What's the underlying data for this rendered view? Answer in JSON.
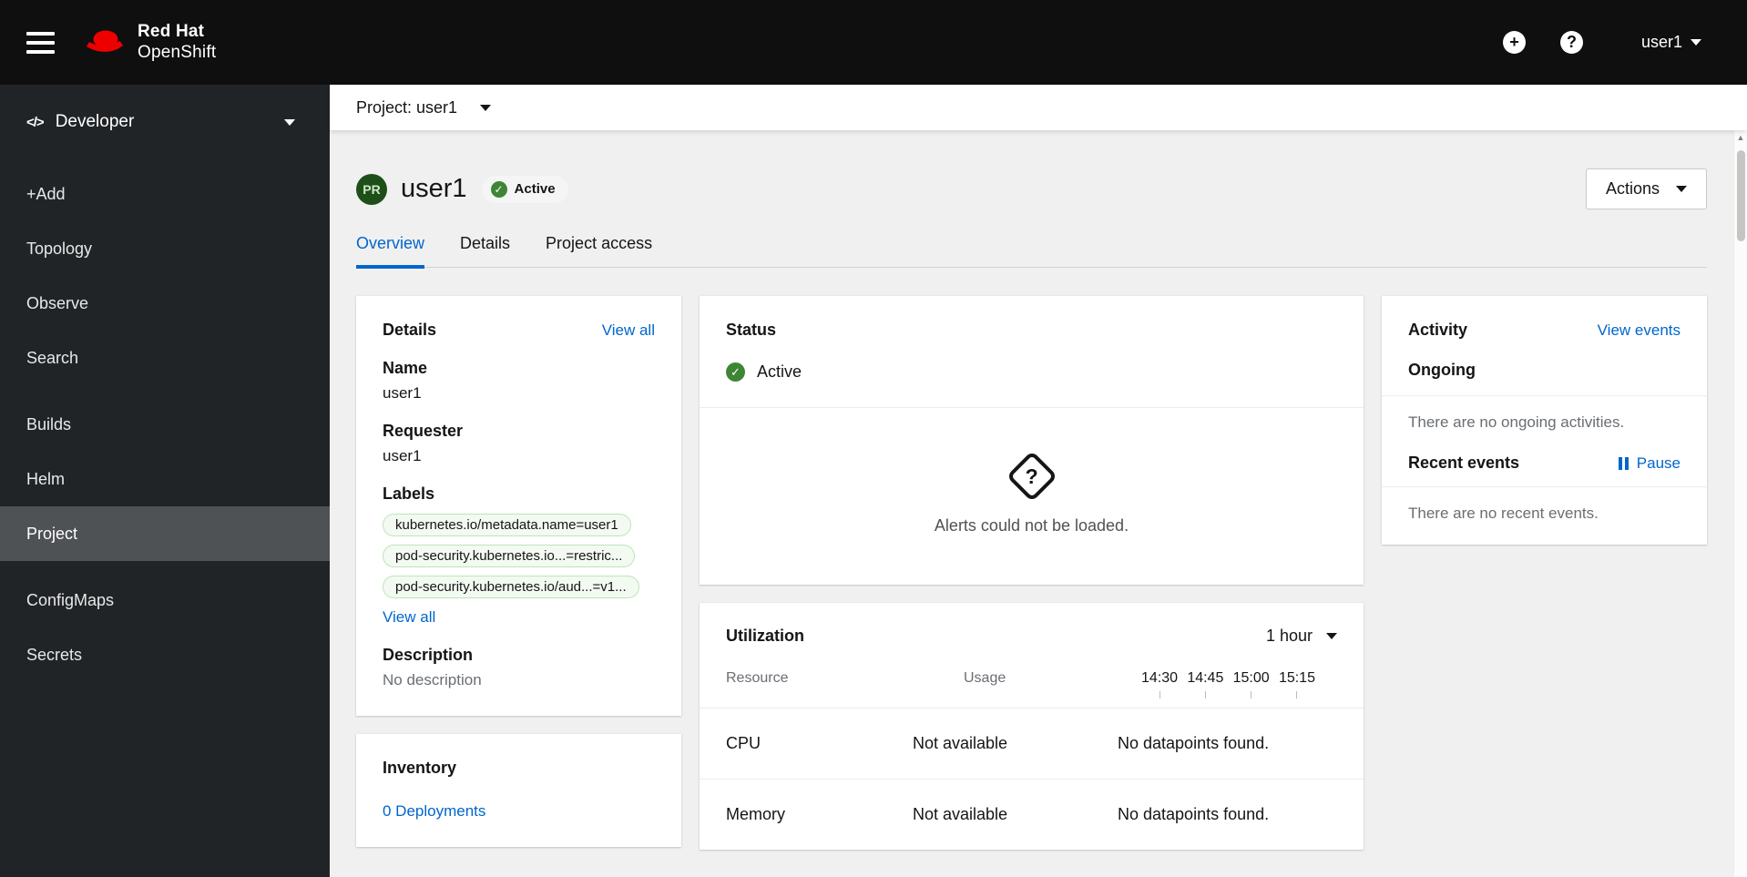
{
  "colors": {
    "accent_blue": "#0066cc",
    "success_green": "#3e8635",
    "brand_red": "#ee0000",
    "project_badge_green": "#1e4f18",
    "label_pill_bg": "#f3faf2",
    "label_pill_border": "#bde5b8",
    "masthead_bg": "#0f0f0f",
    "sidebar_bg": "#212427",
    "sidebar_selected_bg": "#4f5255"
  },
  "icons": {
    "plus": "+",
    "question": "?",
    "check": "✓",
    "code": "</>"
  },
  "masthead": {
    "brand_line1": "Red Hat",
    "brand_line2": "OpenShift",
    "user_menu": "user1"
  },
  "sidebar": {
    "perspective": "Developer",
    "groups": [
      {
        "items": [
          "+Add",
          "Topology",
          "Observe",
          "Search"
        ]
      },
      {
        "items": [
          "Builds",
          "Helm",
          "Project"
        ]
      },
      {
        "items": [
          "ConfigMaps",
          "Secrets"
        ]
      }
    ],
    "selected_item": "Project"
  },
  "project_bar": {
    "label": "Project: user1"
  },
  "page_header": {
    "resource_badge": "PR",
    "title": "user1",
    "status_badge": "Active",
    "actions_label": "Actions"
  },
  "tabs": {
    "items": [
      "Overview",
      "Details",
      "Project access"
    ],
    "active": "Overview"
  },
  "details": {
    "title": "Details",
    "view_all": "View all",
    "name_label": "Name",
    "name_value": "user1",
    "requester_label": "Requester",
    "requester_value": "user1",
    "labels_label": "Labels",
    "labels": [
      "kubernetes.io/metadata.name=user1",
      "pod-security.kubernetes.io...=restric...",
      "pod-security.kubernetes.io/aud...=v1..."
    ],
    "labels_view_all": "View all",
    "description_label": "Description",
    "description_value": "No description"
  },
  "status": {
    "title": "Status",
    "state": "Active",
    "alerts_empty": "Alerts could not be loaded."
  },
  "utilization": {
    "title": "Utilization",
    "range": "1 hour",
    "col_resource": "Resource",
    "col_usage": "Usage",
    "times": [
      "14:30",
      "14:45",
      "15:00",
      "15:15"
    ],
    "rows": [
      {
        "name": "CPU",
        "usage": "Not available",
        "message": "No datapoints found."
      },
      {
        "name": "Memory",
        "usage": "Not available",
        "message": "No datapoints found."
      }
    ]
  },
  "activity": {
    "title": "Activity",
    "view_events": "View events",
    "ongoing_label": "Ongoing",
    "ongoing_empty": "There are no ongoing activities.",
    "recent_label": "Recent events",
    "pause_label": "Pause",
    "recent_empty": "There are no recent events."
  },
  "inventory": {
    "title": "Inventory",
    "links": [
      "0 Deployments"
    ]
  }
}
